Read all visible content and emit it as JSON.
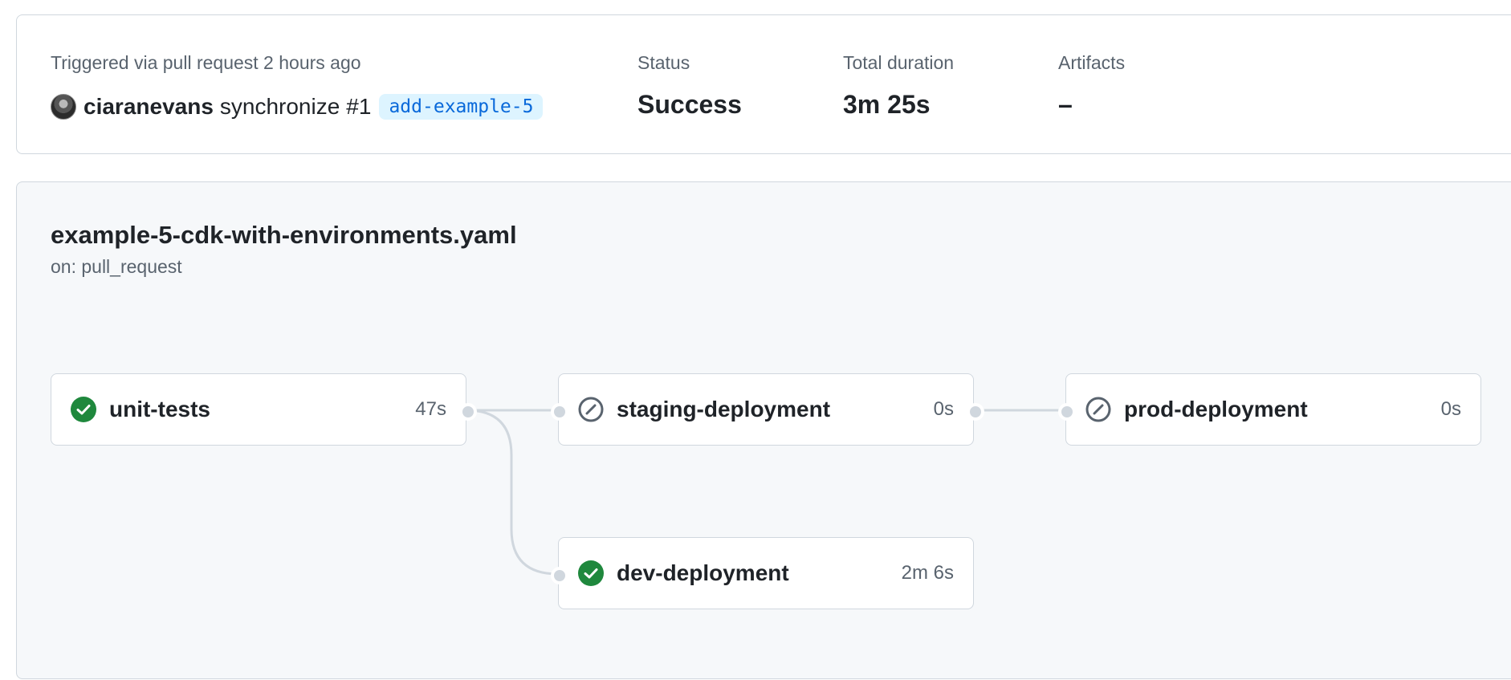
{
  "summary": {
    "trigger_label": "Triggered via pull request 2 hours ago",
    "actor": "ciaranevans",
    "event": "synchronize",
    "pr_number": "#1",
    "branch": "add-example-5",
    "status_label": "Status",
    "status_value": "Success",
    "duration_label": "Total duration",
    "duration_value": "3m 25s",
    "artifacts_label": "Artifacts",
    "artifacts_value": "–"
  },
  "workflow": {
    "file_name": "example-5-cdk-with-environments.yaml",
    "trigger": "on: pull_request",
    "jobs": [
      {
        "name": "unit-tests",
        "duration": "47s",
        "state": "success",
        "icon": "check-circle-icon"
      },
      {
        "name": "staging-deployment",
        "duration": "0s",
        "state": "skipped",
        "icon": "skip-icon"
      },
      {
        "name": "prod-deployment",
        "duration": "0s",
        "state": "skipped",
        "icon": "skip-icon"
      },
      {
        "name": "dev-deployment",
        "duration": "2m 6s",
        "state": "success",
        "icon": "check-circle-icon"
      }
    ]
  },
  "colors": {
    "success": "#1f883d",
    "skipped": "#59636e",
    "branch_bg": "#ddf4ff",
    "branch_fg": "#0969da",
    "connector": "#d0d7de"
  }
}
